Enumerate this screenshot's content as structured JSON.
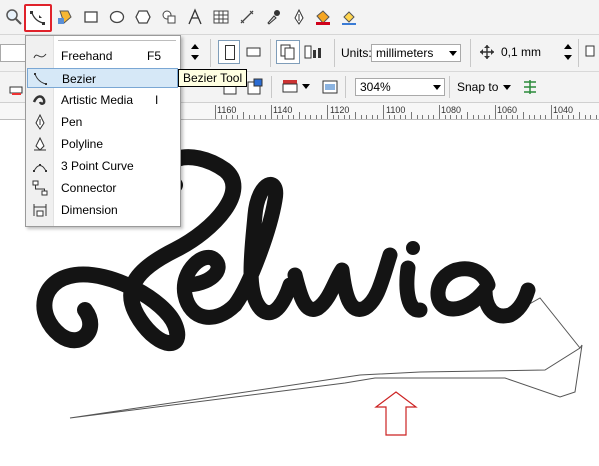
{
  "toolbox": {
    "icons": [
      "zoom-icon",
      "bezier-tool-icon",
      "smart-fill-icon",
      "rectangle-icon",
      "ellipse-icon",
      "polygon-icon",
      "basic-shapes-icon",
      "text-icon",
      "table-icon",
      "eyedropper-icon",
      "outline-pen-icon",
      "fill-bucket-icon",
      "interactive-fill-icon"
    ]
  },
  "property_bar": {
    "units_label": "Units:",
    "units_value": "millimeters",
    "nudge_value": "0,1 mm"
  },
  "property_bar2": {
    "zoom_value": "304%",
    "snap_to_label": "Snap to"
  },
  "ruler": {
    "labels": [
      "1160",
      "1140",
      "1120",
      "1100",
      "1080",
      "1060",
      "1040"
    ]
  },
  "flyout": {
    "items": [
      {
        "label": "Freehand",
        "shortcut": "F5",
        "icon": "freehand-icon"
      },
      {
        "label": "Bezier",
        "shortcut": "",
        "icon": "bezier-icon"
      },
      {
        "label": "Artistic Media",
        "shortcut": "I",
        "icon": "artistic-media-icon"
      },
      {
        "label": "Pen",
        "shortcut": "",
        "icon": "pen-icon"
      },
      {
        "label": "Polyline",
        "shortcut": "",
        "icon": "polyline-icon"
      },
      {
        "label": "3 Point Curve",
        "shortcut": "",
        "icon": "three-point-curve-icon"
      },
      {
        "label": "Connector",
        "shortcut": "",
        "icon": "connector-icon"
      },
      {
        "label": "Dimension",
        "shortcut": "",
        "icon": "dimension-icon"
      }
    ],
    "highlighted_index": 1
  },
  "tooltip": {
    "text": "Bezier Tool"
  },
  "canvas": {
    "artwork_text": "Selvia",
    "artwork_color": "#141414",
    "arrow_color": "#cc2222",
    "outline_color": "#555555"
  },
  "colors": {
    "active_tool_border": "#e0222b",
    "highlight_bg": "#d6e8f7"
  }
}
